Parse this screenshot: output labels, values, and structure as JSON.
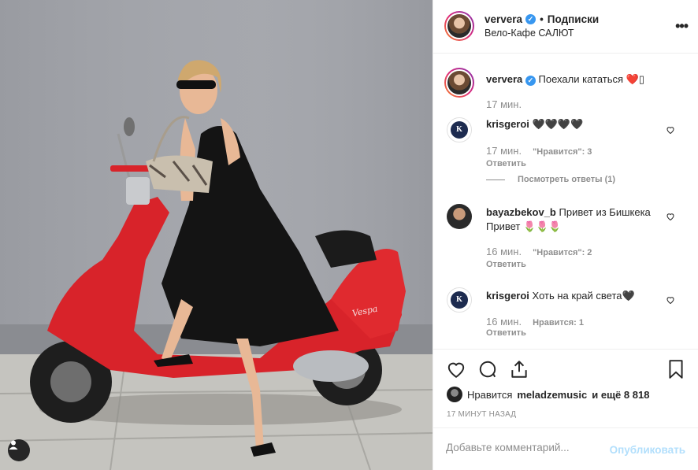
{
  "post": {
    "header": {
      "username": "ververa",
      "verified_icon": "verified-badge-icon",
      "separator": "•",
      "follow_label": "Подписки",
      "location": "Вело-Кафе САЛЮТ",
      "more_icon": "more-options-icon"
    },
    "caption": {
      "username": "ververa",
      "text": "Поехали кататься ❤️▯",
      "time": "17 мин."
    },
    "comments": [
      {
        "username": "krisgeroi",
        "text": "🖤🖤🖤🖤",
        "time": "17 мин.",
        "likes": "\"Нравится\": 3",
        "reply": "Ответить",
        "view_replies": "Посмотреть ответы (1)"
      },
      {
        "username": "bayazbekov_b",
        "text": "Привет из Бишкека Привет 🌷🌷🌷",
        "time": "16 мин.",
        "likes": "\"Нравится\": 2",
        "reply": "Ответить"
      },
      {
        "username": "krisgeroi",
        "text": "Хоть на край света🖤",
        "time": "16 мин.",
        "likes": "Нравится: 1",
        "reply": "Ответить"
      }
    ],
    "actions": {
      "like_icon": "heart-icon",
      "comment_icon": "comment-icon",
      "share_icon": "share-icon",
      "save_icon": "bookmark-icon"
    },
    "likes_summary": {
      "prefix": "Нравится",
      "user": "meladzemusic",
      "suffix": "и ещё 8 818"
    },
    "timestamp": "17 МИНУТ НАЗАД",
    "add_comment": {
      "placeholder": "Добавьте комментарий...",
      "post_label": "Опубликовать"
    },
    "photo": {
      "tag_icon": "user-tag-icon",
      "scooter_brand": "Vespa"
    }
  },
  "colors": {
    "accent": "#3897f0",
    "text": "#262626",
    "muted": "#8e8e8e",
    "post_disabled": "#b2dffc",
    "scooter_red": "#d8232a",
    "wall_gray": "#9d9fa5"
  }
}
